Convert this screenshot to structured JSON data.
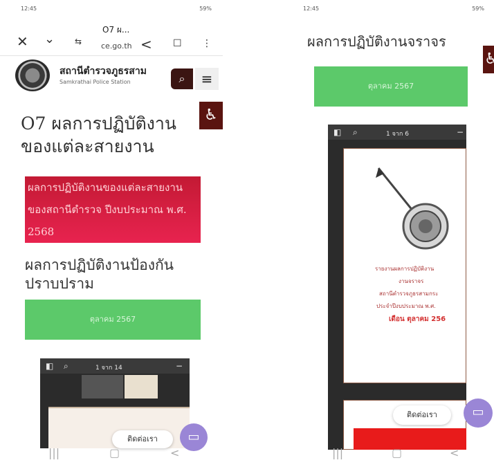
{
  "left": {
    "status": {
      "time": "12:45",
      "system": "59%"
    },
    "browser": {
      "tab_title": "O7 ผ...",
      "domain": "ce.go.th",
      "icons": [
        "close-icon",
        "chevron-down-icon",
        "tabs-icon",
        "share-icon",
        "bookmark-icon",
        "more-icon"
      ]
    },
    "site": {
      "name": "สถานีตำรวจภูธรสาม",
      "subtitle": "Samkrathai Police Station"
    },
    "heading": "O7 ผลการปฏิบัติงานของแต่ละสายงาน",
    "banner_text": "ผลการปฏิบัติงานของแต่ละสายงานของสถานีตำรวจ ปีงบประมาณ พ.ศ. 2568",
    "subheading": "ผลการปฏิบัติงานป้องกันปราบปราม",
    "green_button": "ตุลาคม 2567",
    "pdf_toolbar": {
      "page": "1 จาก 14"
    },
    "contact_label": "ติดต่อเรา"
  },
  "right": {
    "status": {
      "time": "12:45",
      "system": "59%"
    },
    "title": "ผลการปฏิบัติงานจราจร",
    "green_button": "ตุลาคม 2567",
    "pdf_toolbar": {
      "page": "1 จาก 6"
    },
    "doc_lines": [
      "รายงานผลการปฏิบัติงาน",
      "งานจราจร",
      "สถานีตำรวจภูธรสามกระ",
      "ประจำปีงบประมาณ พ.ศ.",
      "เดือน ตุลาคม 256"
    ],
    "contact_label": "ติดต่อเรา"
  },
  "colors": {
    "accent_dark": "#3b1512",
    "banner_red": "#d81f45",
    "button_green": "#5cc96a",
    "chat_purple": "#9a86d6"
  }
}
